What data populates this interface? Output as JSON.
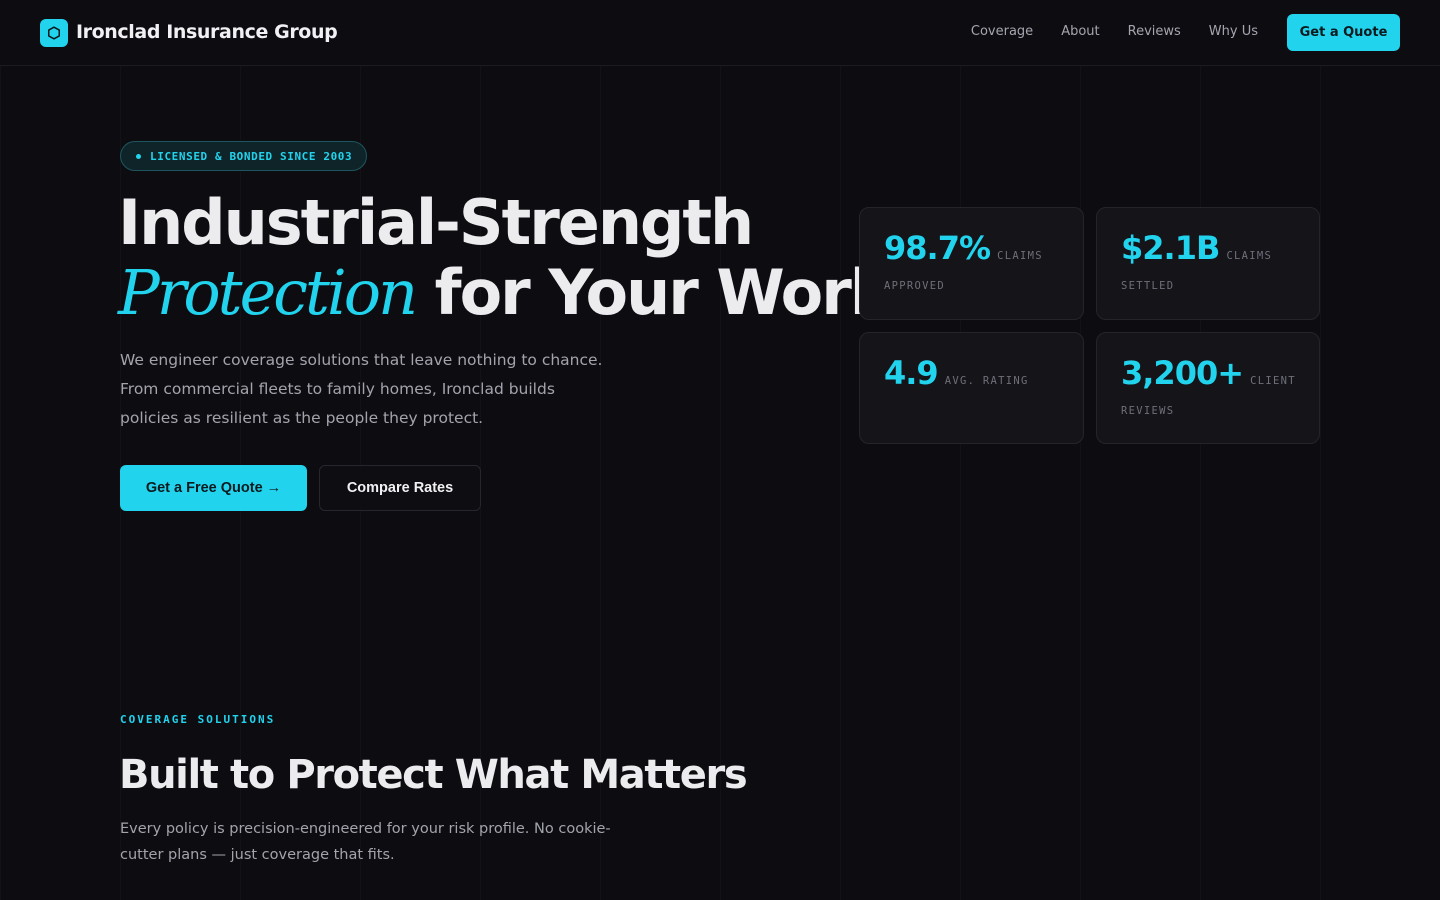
{
  "brand": {
    "name": "Ironclad Insurance Group",
    "accent_color": "#22d3ee",
    "logo_icon": "hexagon-icon"
  },
  "nav": {
    "links": [
      "Coverage",
      "About",
      "Reviews",
      "Why Us"
    ],
    "cta_label": "Get a Quote"
  },
  "hero": {
    "badge": "LICENSED & BONDED SINCE 2003",
    "title_line1": "Industrial-Strength",
    "title_accent": "Protection",
    "title_line2_rest": " for Your World",
    "subtitle": "We engineer coverage solutions that leave nothing to chance. From commercial fleets to family homes, Ironclad builds policies as resilient as the people they protect.",
    "primary_button": "Get a Free Quote →",
    "secondary_button": "Compare Rates"
  },
  "stats": [
    {
      "value": "98.7%",
      "label": "Claims Approved"
    },
    {
      "value": "$2.1B",
      "label": "Claims Settled"
    },
    {
      "value": "4.9",
      "label": "Avg. Rating"
    },
    {
      "value": "3,200+",
      "label": "Client Reviews"
    }
  ],
  "coverage_section": {
    "eyebrow": "COVERAGE SOLUTIONS",
    "title": "Built to Protect What Matters",
    "subtitle": "Every policy is precision-engineered for your risk profile. No cookie-cutter plans — just coverage that fits."
  }
}
